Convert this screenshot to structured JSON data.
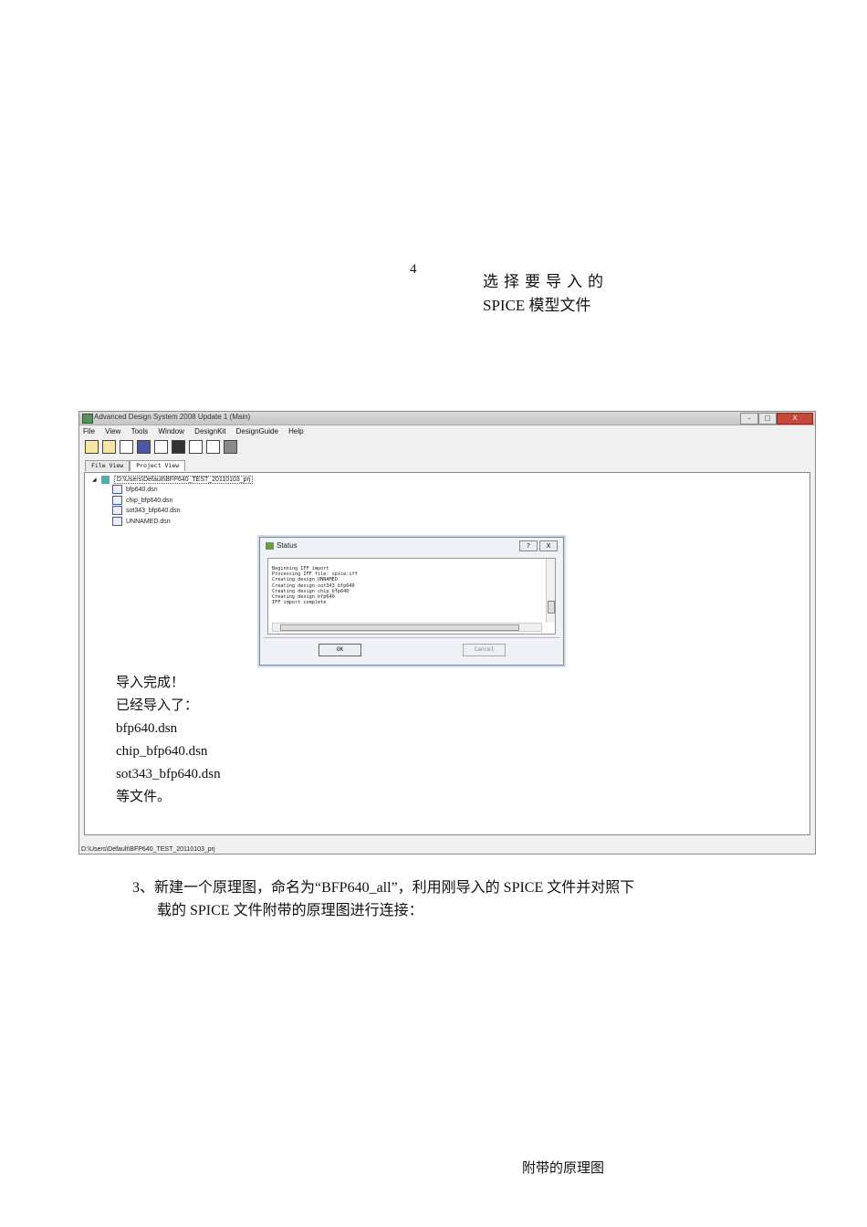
{
  "doc": {
    "step_number": "4",
    "callout_line1": "选择要导入的",
    "callout_line2": "SPICE 模型文件",
    "instruction_line1": "3、新建一个原理图，命名为“BFP640_all”，利用刚导入的 SPICE 文件并对照下",
    "instruction_line2": "载的 SPICE 文件附带的原理图进行连接：",
    "caption": "附带的原理图"
  },
  "window": {
    "title": "Advanced Design System 2008 Update 1 (Main)",
    "controls": {
      "minimize": "–",
      "maximize": "□",
      "close": "X"
    },
    "menu": [
      "File",
      "View",
      "Tools",
      "Window",
      "DesignKit",
      "DesignGuide",
      "Help"
    ],
    "toolbar_icons": [
      "open-folder-icon",
      "open-project-icon",
      "schematic-icon",
      "layout-icon",
      "data-display-icon",
      "simulate-icon",
      "text-editor-icon",
      "copy-icon",
      "windows-icon"
    ],
    "tabs": [
      "File View",
      "Project View"
    ],
    "active_tab": "Project View",
    "tree": {
      "root_collapse": "◢",
      "root": "D:\\Users\\Default\\BFP640_TEST_20110103_prj",
      "items": [
        "bfp640.dsn",
        "chip_bfp640.dsn",
        "sot343_bfp640.dsn",
        "UNNAMED.dsn"
      ]
    },
    "status_bar": "D:\\Users\\Default\\BFP640_TEST_20110103_prj"
  },
  "status_dialog": {
    "title": "Status",
    "help": "?",
    "close": "X",
    "log": [
      "Beginning IFF import",
      "Processing IFF file: spice.iff",
      "Creating design UNNAMED",
      "Creating design sot343_bfp640",
      "Creating design chip_bfp640",
      "Creating design bfp640",
      "IFF import complete"
    ],
    "ok_label": "OK",
    "cancel_label": "Cancel"
  },
  "note": {
    "lines": [
      "导入完成！",
      "已经导入了：",
      "bfp640.dsn",
      "chip_bfp640.dsn",
      "sot343_bfp640.dsn",
      "等文件。"
    ]
  }
}
